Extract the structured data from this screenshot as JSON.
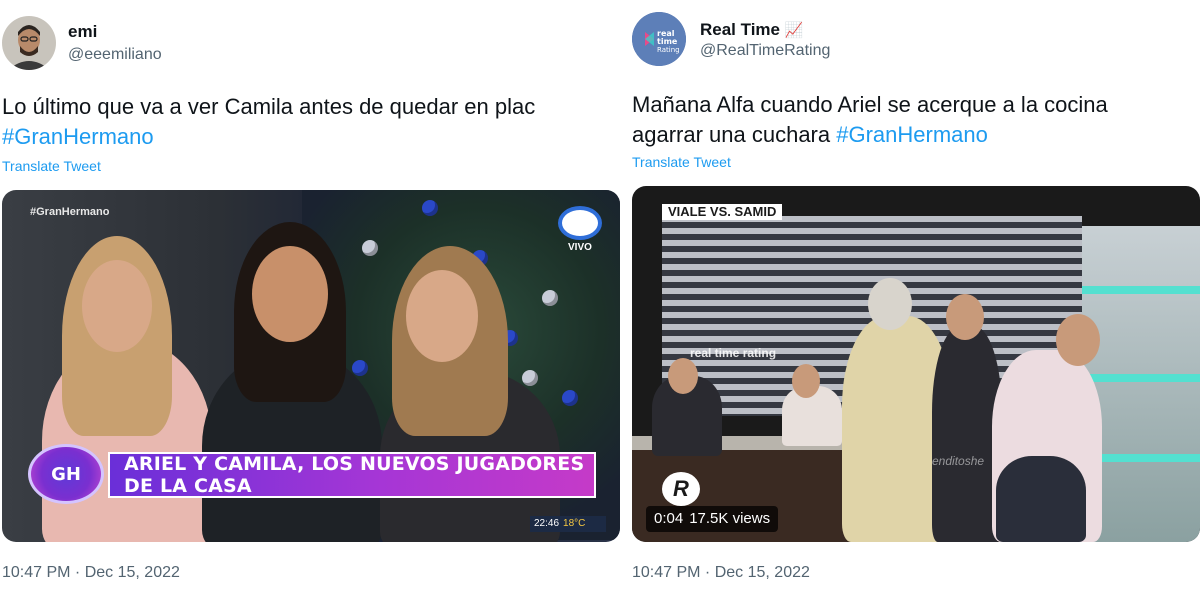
{
  "left_tweet": {
    "author_name": "emi",
    "author_handle": "@eeemiliano",
    "text": "Lo último que va a ver Camila antes de quedar en plac",
    "hashtag": "#GranHermano",
    "translate": "Translate Tweet",
    "timestamp": "10:47 PM · Dec 15, 2022",
    "media": {
      "corner_hashtag": "#GranHermano",
      "live_label": "VIVO",
      "gh_logo": "GH",
      "banner": "ARIEL Y CAMILA, LOS NUEVOS JUGADORES DE LA CASA",
      "clock_time": "22:46",
      "clock_temp": "18°C"
    }
  },
  "right_tweet": {
    "author_name": "Real Time",
    "author_emoji": "📈",
    "author_handle": "@RealTimeRating",
    "avatar_text": "real time rating",
    "text_line1": "Mañana Alfa cuando Ariel se acerque a la cocina",
    "text_line2_prefix": "agarrar una cuchara",
    "hashtag": "#GranHermano",
    "translate": "Translate Tweet",
    "timestamp": "10:47 PM · Dec 15, 2022",
    "media": {
      "label": "VIALE VS. SAMID",
      "logo": "real time rating",
      "watermark": "enditoshe",
      "video_icon": "R",
      "duration": "0:04",
      "views": "17.5K views"
    }
  },
  "colors": {
    "link": "#1d9bf0",
    "secondary_text": "#536471",
    "primary_text": "#0f1419"
  }
}
